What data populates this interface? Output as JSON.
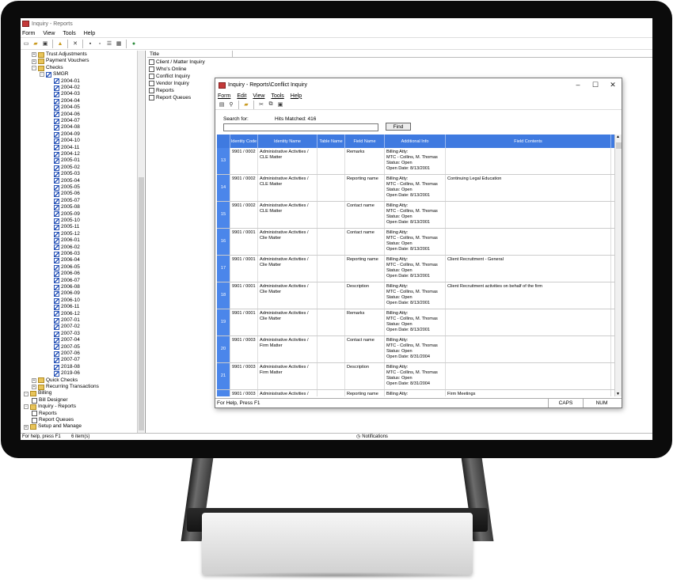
{
  "window": {
    "title": "Inquiry - Reports"
  },
  "menu": [
    "Form",
    "View",
    "Tools",
    "Help"
  ],
  "tree": [
    {
      "level": 1,
      "pm": "+",
      "icon": "folder",
      "label": "Trust Adjustments"
    },
    {
      "level": 1,
      "pm": "+",
      "icon": "folder",
      "label": "Payment Vouchers"
    },
    {
      "level": 1,
      "pm": "-",
      "icon": "folder",
      "label": "Checks"
    },
    {
      "level": 2,
      "pm": "-",
      "icon": "check",
      "label": "SMGR"
    },
    {
      "level": 3,
      "pm": "",
      "icon": "check",
      "label": "2004-01"
    },
    {
      "level": 3,
      "pm": "",
      "icon": "check",
      "label": "2004-02"
    },
    {
      "level": 3,
      "pm": "",
      "icon": "check",
      "label": "2004-03"
    },
    {
      "level": 3,
      "pm": "",
      "icon": "check",
      "label": "2004-04"
    },
    {
      "level": 3,
      "pm": "",
      "icon": "check",
      "label": "2004-05"
    },
    {
      "level": 3,
      "pm": "",
      "icon": "check",
      "label": "2004-06"
    },
    {
      "level": 3,
      "pm": "",
      "icon": "check",
      "label": "2004-07"
    },
    {
      "level": 3,
      "pm": "",
      "icon": "check",
      "label": "2004-08"
    },
    {
      "level": 3,
      "pm": "",
      "icon": "check",
      "label": "2004-09"
    },
    {
      "level": 3,
      "pm": "",
      "icon": "check",
      "label": "2004-10"
    },
    {
      "level": 3,
      "pm": "",
      "icon": "check",
      "label": "2004-11"
    },
    {
      "level": 3,
      "pm": "",
      "icon": "check",
      "label": "2004-12"
    },
    {
      "level": 3,
      "pm": "",
      "icon": "check",
      "label": "2005-01"
    },
    {
      "level": 3,
      "pm": "",
      "icon": "check",
      "label": "2005-02"
    },
    {
      "level": 3,
      "pm": "",
      "icon": "check",
      "label": "2005-03"
    },
    {
      "level": 3,
      "pm": "",
      "icon": "check",
      "label": "2005-04"
    },
    {
      "level": 3,
      "pm": "",
      "icon": "check",
      "label": "2005-05"
    },
    {
      "level": 3,
      "pm": "",
      "icon": "check",
      "label": "2005-06"
    },
    {
      "level": 3,
      "pm": "",
      "icon": "check",
      "label": "2005-07"
    },
    {
      "level": 3,
      "pm": "",
      "icon": "check",
      "label": "2005-08"
    },
    {
      "level": 3,
      "pm": "",
      "icon": "check",
      "label": "2005-09"
    },
    {
      "level": 3,
      "pm": "",
      "icon": "check",
      "label": "2005-10"
    },
    {
      "level": 3,
      "pm": "",
      "icon": "check",
      "label": "2005-11"
    },
    {
      "level": 3,
      "pm": "",
      "icon": "check",
      "label": "2005-12"
    },
    {
      "level": 3,
      "pm": "",
      "icon": "check",
      "label": "2006-01"
    },
    {
      "level": 3,
      "pm": "",
      "icon": "check",
      "label": "2006-02"
    },
    {
      "level": 3,
      "pm": "",
      "icon": "check",
      "label": "2006-03"
    },
    {
      "level": 3,
      "pm": "",
      "icon": "check",
      "label": "2006-04"
    },
    {
      "level": 3,
      "pm": "",
      "icon": "check",
      "label": "2006-05"
    },
    {
      "level": 3,
      "pm": "",
      "icon": "check",
      "label": "2006-06"
    },
    {
      "level": 3,
      "pm": "",
      "icon": "check",
      "label": "2006-07"
    },
    {
      "level": 3,
      "pm": "",
      "icon": "check",
      "label": "2006-08"
    },
    {
      "level": 3,
      "pm": "",
      "icon": "check",
      "label": "2006-09"
    },
    {
      "level": 3,
      "pm": "",
      "icon": "check",
      "label": "2006-10"
    },
    {
      "level": 3,
      "pm": "",
      "icon": "check",
      "label": "2006-11"
    },
    {
      "level": 3,
      "pm": "",
      "icon": "check",
      "label": "2006-12"
    },
    {
      "level": 3,
      "pm": "",
      "icon": "check",
      "label": "2007-01"
    },
    {
      "level": 3,
      "pm": "",
      "icon": "check",
      "label": "2007-02"
    },
    {
      "level": 3,
      "pm": "",
      "icon": "check",
      "label": "2007-03"
    },
    {
      "level": 3,
      "pm": "",
      "icon": "check",
      "label": "2007-04"
    },
    {
      "level": 3,
      "pm": "",
      "icon": "check",
      "label": "2007-05"
    },
    {
      "level": 3,
      "pm": "",
      "icon": "check",
      "label": "2007-06"
    },
    {
      "level": 3,
      "pm": "",
      "icon": "check",
      "label": "2007-07"
    },
    {
      "level": 3,
      "pm": "",
      "icon": "check",
      "label": "2018-08"
    },
    {
      "level": 3,
      "pm": "",
      "icon": "check",
      "label": "2019-06"
    },
    {
      "level": 1,
      "pm": "+",
      "icon": "folder",
      "label": "Quick Checks"
    },
    {
      "level": 1,
      "pm": "+",
      "icon": "folder",
      "label": "Recurring Transactions"
    },
    {
      "level": 0,
      "pm": "-",
      "icon": "folder",
      "label": "Billing"
    },
    {
      "level": 1,
      "pm": "",
      "icon": "doc",
      "label": "Bill Designer"
    },
    {
      "level": 0,
      "pm": "-",
      "icon": "folder",
      "label": "Inquiry - Reports"
    },
    {
      "level": 1,
      "pm": "",
      "icon": "doc",
      "label": "Reports"
    },
    {
      "level": 1,
      "pm": "",
      "icon": "doc",
      "label": "Report Queues"
    },
    {
      "level": 0,
      "pm": "+",
      "icon": "folder",
      "label": "Setup and Manage"
    }
  ],
  "list": {
    "header": "Title",
    "items": [
      "Client / Matter Inquiry",
      "Who's Online",
      "Conflict Inquiry",
      "Vendor Inquiry",
      "Reports",
      "Report Queues"
    ]
  },
  "statusbar": {
    "help": "For help, press F1",
    "count": "6 item(s)",
    "notifications": "Notifications"
  },
  "dialog": {
    "title": "Inquiry - Reports\\Conflict Inquiry",
    "menu": [
      "Form",
      "Edit",
      "View",
      "Tools",
      "Help"
    ],
    "search_label": "Search for:",
    "hits_label": "Hits Matched:  416",
    "search_value": "",
    "find_label": "Find",
    "status_help": "For Help, Press F1",
    "caps": "CAPS",
    "num": "NUM"
  },
  "grid": {
    "columns": [
      "",
      "Identity Code",
      "Identity Name",
      "Table Name",
      "Field Name",
      "Additional Info",
      "Field Contents"
    ],
    "rows": [
      {
        "n": "13",
        "code": "9901 / 0002",
        "name": "Administrative Activities / CLE Matter",
        "table": "",
        "field": "Remarks",
        "info": [
          "Billing Atty:",
          "MTC - Collins, M. Thomas",
          "Status: Open",
          "Open Date: 8/13/2001"
        ],
        "contents": ""
      },
      {
        "n": "14",
        "code": "9901 / 0002",
        "name": "Administrative Activities / CLE Matter",
        "table": "",
        "field": "Reporting name",
        "info": [
          "Billing Atty:",
          "MTC - Collins, M. Thomas",
          "Status: Open",
          "Open Date: 8/13/2001"
        ],
        "contents": "Continuing Legal Education"
      },
      {
        "n": "15",
        "code": "9901 / 0002",
        "name": "Administrative Activities / CLE Matter",
        "table": "",
        "field": "Contact name",
        "info": [
          "Billing Atty:",
          "MTC - Collins, M. Thomas",
          "Status: Open",
          "Open Date: 8/13/2001"
        ],
        "contents": ""
      },
      {
        "n": "16",
        "code": "9901 / 0001",
        "name": "Administrative Activities / Clie Matter",
        "table": "",
        "field": "Contact name",
        "info": [
          "Billing Atty:",
          "MTC - Collins, M. Thomas",
          "Status: Open",
          "Open Date: 8/13/2001"
        ],
        "contents": ""
      },
      {
        "n": "17",
        "code": "9901 / 0001",
        "name": "Administrative Activities / Clie Matter",
        "table": "",
        "field": "Reporting name",
        "info": [
          "Billing Atty:",
          "MTC - Collins, M. Thomas",
          "Status: Open",
          "Open Date: 8/13/2001"
        ],
        "contents": "Client Recruitment - General"
      },
      {
        "n": "18",
        "code": "9901 / 0001",
        "name": "Administrative Activities / Clie Matter",
        "table": "",
        "field": "Description",
        "info": [
          "Billing Atty:",
          "MTC - Collins, M. Thomas",
          "Status: Open",
          "Open Date: 8/13/2001"
        ],
        "contents": "Client Recruitment activities on behalf  of the firm"
      },
      {
        "n": "19",
        "code": "9901 / 0001",
        "name": "Administrative Activities / Clie Matter",
        "table": "",
        "field": "Remarks",
        "info": [
          "Billing Atty:",
          "MTC - Collins, M. Thomas",
          "Status: Open",
          "Open Date: 8/13/2001"
        ],
        "contents": ""
      },
      {
        "n": "20",
        "code": "9901 / 0003",
        "name": "Administrative Activities / Firm Matter",
        "table": "",
        "field": "Contact name",
        "info": [
          "Billing Atty:",
          "MTC - Collins, M. Thomas",
          "Status: Open",
          "Open Date: 8/31/2004"
        ],
        "contents": ""
      },
      {
        "n": "21",
        "code": "9901 / 0003",
        "name": "Administrative Activities / Firm Matter",
        "table": "",
        "field": "Description",
        "info": [
          "Billing Atty:",
          "MTC - Collins, M. Thomas",
          "Status: Open",
          "Open Date: 8/31/2004"
        ],
        "contents": ""
      },
      {
        "n": "22",
        "code": "9901 / 0003",
        "name": "Administrative Activities / Firm Matter",
        "table": "",
        "field": "Reporting name",
        "info": [
          "Billing Atty:",
          "MTC - Collins, M. Thomas"
        ],
        "contents": "Firm Meetings"
      }
    ]
  },
  "colors": {
    "grid_header": "#3f7ae0",
    "row_number": "#4b86ea",
    "bezel": "#0b0b0b"
  }
}
